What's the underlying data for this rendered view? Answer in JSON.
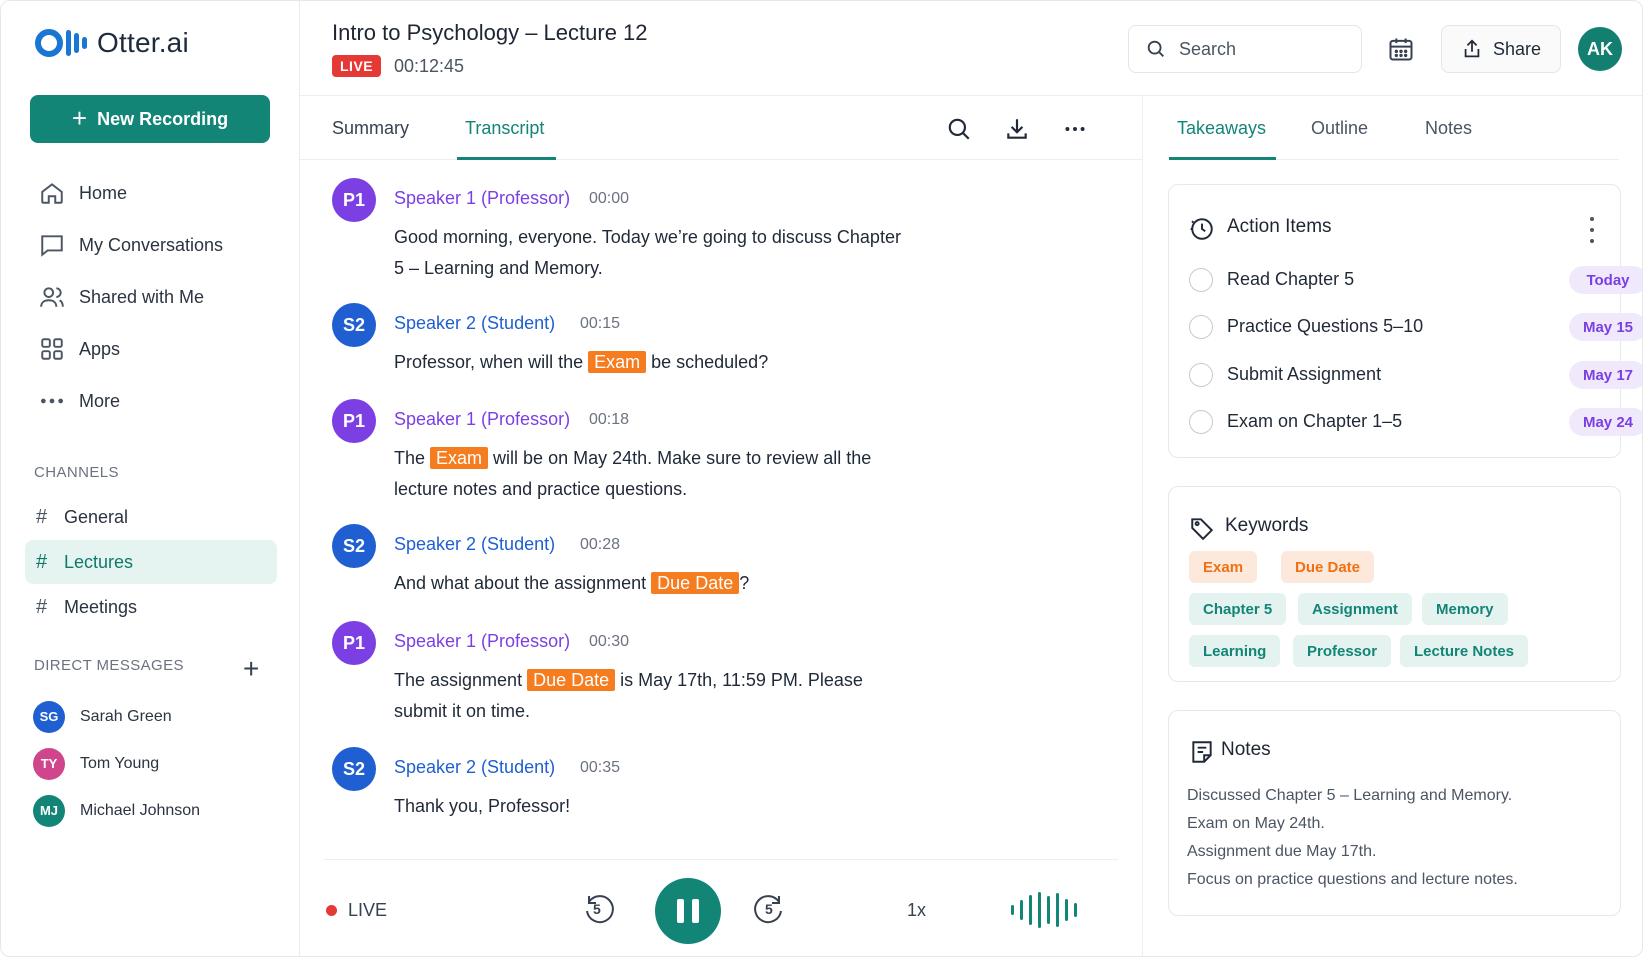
{
  "app": {
    "name": "Otter.ai"
  },
  "sidebar": {
    "new_recording": "New Recording",
    "nav": [
      {
        "label": "Home",
        "icon": "home-icon"
      },
      {
        "label": "My Conversations",
        "icon": "conversations-icon"
      },
      {
        "label": "Shared with Me",
        "icon": "users-icon"
      },
      {
        "label": "Apps",
        "icon": "apps-icon"
      },
      {
        "label": "More",
        "icon": "more-dots-icon"
      }
    ],
    "channels_label": "CHANNELS",
    "channels": [
      {
        "label": "General",
        "active": false
      },
      {
        "label": "Lectures",
        "active": true
      },
      {
        "label": "Meetings",
        "active": false
      }
    ],
    "dm_label": "DIRECT MESSAGES",
    "dms": [
      {
        "initials": "SG",
        "name": "Sarah Green",
        "color": "#1f5fd1"
      },
      {
        "initials": "TY",
        "name": "Tom Young",
        "color": "#d0468c"
      },
      {
        "initials": "MJ",
        "name": "Michael Johnson",
        "color": "#138577"
      }
    ]
  },
  "header": {
    "title": "Intro to Psychology – Lecture 12",
    "live_badge": "LIVE",
    "timer": "00:12:45",
    "search_placeholder": "Search",
    "share_label": "Share",
    "user_initials": "AK"
  },
  "center": {
    "tabs": [
      {
        "label": "Summary",
        "active": false
      },
      {
        "label": "Transcript",
        "active": true
      }
    ],
    "transcript": [
      {
        "initials": "P1",
        "speaker": "Speaker 1 (Professor)",
        "time": "00:00",
        "parts": [
          {
            "t": "Good morning, everyone. Today we’re going to discuss Chapter 5 – Learning and Memory."
          }
        ]
      },
      {
        "initials": "S2",
        "speaker": "Speaker 2 (Student)",
        "time": "00:15",
        "parts": [
          {
            "t": "Professor, when will the "
          },
          {
            "t": "Exam",
            "hl": true
          },
          {
            "t": " be scheduled?"
          }
        ]
      },
      {
        "initials": "P1",
        "speaker": "Speaker 1 (Professor)",
        "time": "00:18",
        "parts": [
          {
            "t": "The "
          },
          {
            "t": "Exam",
            "hl": true
          },
          {
            "t": " will be on May 24th. Make sure to review all the lecture notes and practice questions."
          }
        ]
      },
      {
        "initials": "S2",
        "speaker": "Speaker 2 (Student)",
        "time": "00:28",
        "parts": [
          {
            "t": "And what about the assignment "
          },
          {
            "t": "Due Date",
            "hl": true
          },
          {
            "t": "?"
          }
        ]
      },
      {
        "initials": "P1",
        "speaker": "Speaker 1 (Professor)",
        "time": "00:30",
        "parts": [
          {
            "t": "The assignment "
          },
          {
            "t": "Due Date",
            "hl": true
          },
          {
            "t": " is May 17th, 11:59 PM. Please submit it on time."
          }
        ]
      },
      {
        "initials": "S2",
        "speaker": "Speaker 2 (Student)",
        "time": "00:35",
        "parts": [
          {
            "t": "Thank you, Professor!"
          }
        ]
      }
    ],
    "player": {
      "live_label": "LIVE",
      "skip_back": "5",
      "skip_forward": "5",
      "speed": "1x"
    }
  },
  "right": {
    "tabs": [
      {
        "label": "Takeaways",
        "active": true
      },
      {
        "label": "Outline",
        "active": false
      },
      {
        "label": "Notes",
        "active": false
      }
    ],
    "action_items": {
      "title": "Action Items",
      "items": [
        {
          "label": "Read Chapter 5",
          "due": "Today"
        },
        {
          "label": "Practice Questions 5–10",
          "due": "May 15"
        },
        {
          "label": "Submit Assignment",
          "due": "May 17"
        },
        {
          "label": "Exam on Chapter 1–5",
          "due": "May 24"
        }
      ]
    },
    "keywords": {
      "title": "Keywords",
      "items": [
        {
          "label": "Exam",
          "style": "orange"
        },
        {
          "label": "Due Date",
          "style": "orange"
        },
        {
          "label": "Chapter 5",
          "style": "teal"
        },
        {
          "label": "Assignment",
          "style": "teal"
        },
        {
          "label": "Memory",
          "style": "teal"
        },
        {
          "label": "Learning",
          "style": "teal"
        },
        {
          "label": "Professor",
          "style": "teal"
        },
        {
          "label": "Lecture Notes",
          "style": "teal"
        }
      ]
    },
    "notes": {
      "title": "Notes",
      "lines": [
        "Discussed Chapter 5 – Learning and Memory.",
        "Exam on May 24th.",
        "Assignment due May 17th.",
        "Focus on practice questions and lecture notes."
      ]
    }
  },
  "colors": {
    "accent": "#138577",
    "professor": "#7b3fe4",
    "student": "#1f5fd1",
    "highlight": "#f57c1f",
    "live": "#e53935"
  }
}
